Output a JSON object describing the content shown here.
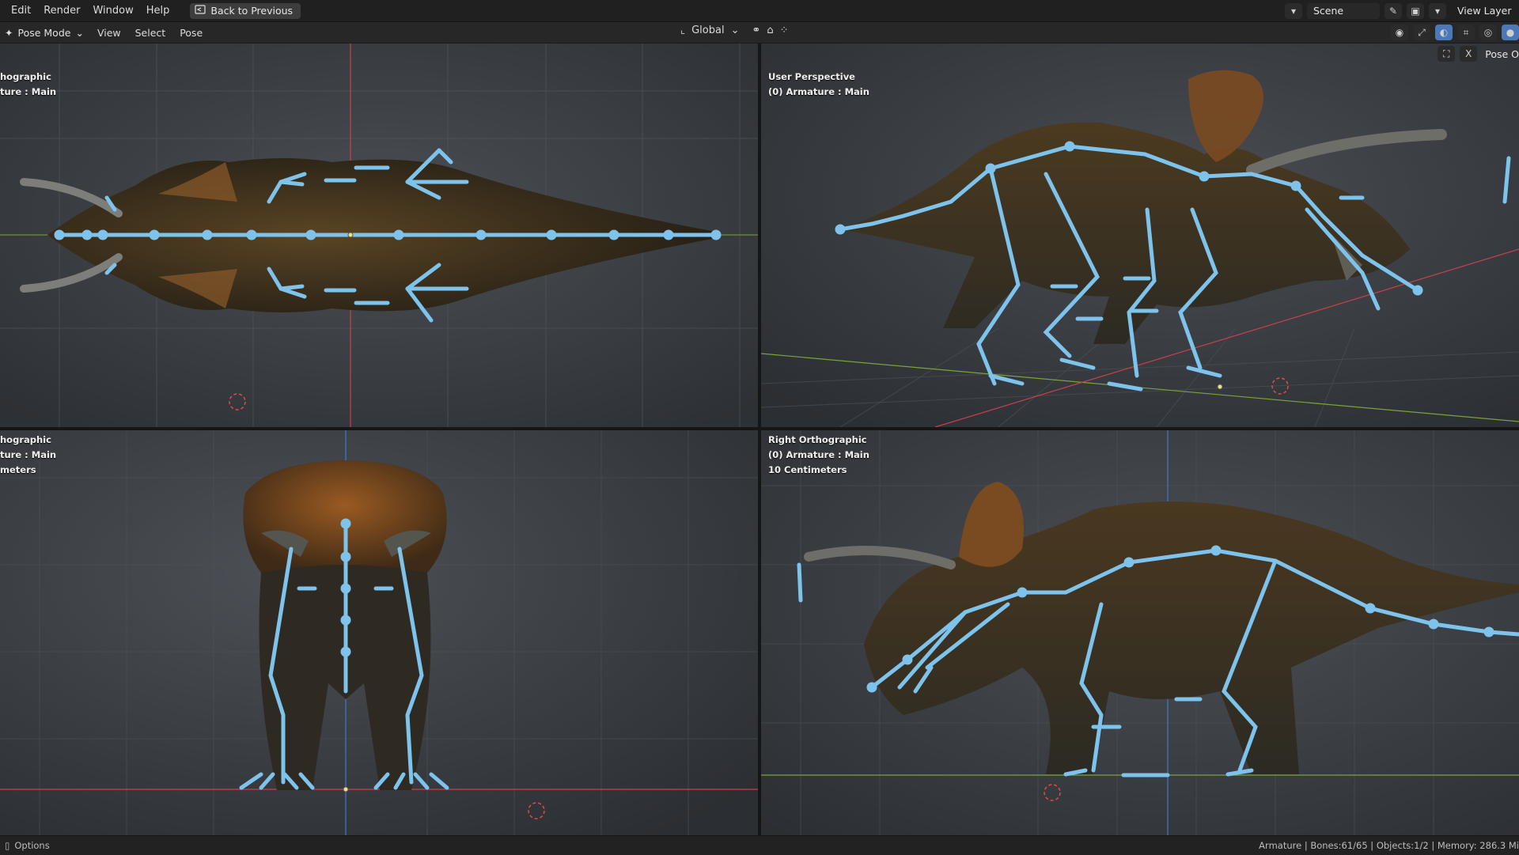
{
  "menu": {
    "items": [
      "Edit",
      "Render",
      "Window",
      "Help"
    ],
    "back_label": "Back to Previous"
  },
  "top_right": {
    "scene": "Scene",
    "view_layer": "View Layer"
  },
  "header": {
    "mode": "Pose Mode",
    "menus": [
      "View",
      "Select",
      "Pose"
    ],
    "orientation": "Global",
    "pose_options": "Pose O"
  },
  "viewports": {
    "top_left": {
      "line1": "hographic",
      "line2": "ture : Main"
    },
    "top_right": {
      "line1": "User Perspective",
      "line2": "(0) Armature : Main"
    },
    "bottom_left": {
      "line1": "hographic",
      "line2": "ture : Main",
      "line3": "meters"
    },
    "bottom_right": {
      "line1": "Right Orthographic",
      "line2": "(0) Armature : Main",
      "line3": "10 Centimeters"
    }
  },
  "status": {
    "options": "Options",
    "info": "Armature | Bones:61/65 | Objects:1/2 | Memory: 286.3 Mi"
  },
  "colors": {
    "bone": "#7ec3ec",
    "axis_red": "#c8414b",
    "axis_green": "#7ba33a",
    "axis_blue": "#3f79c9",
    "bg": "#3a3d42"
  }
}
